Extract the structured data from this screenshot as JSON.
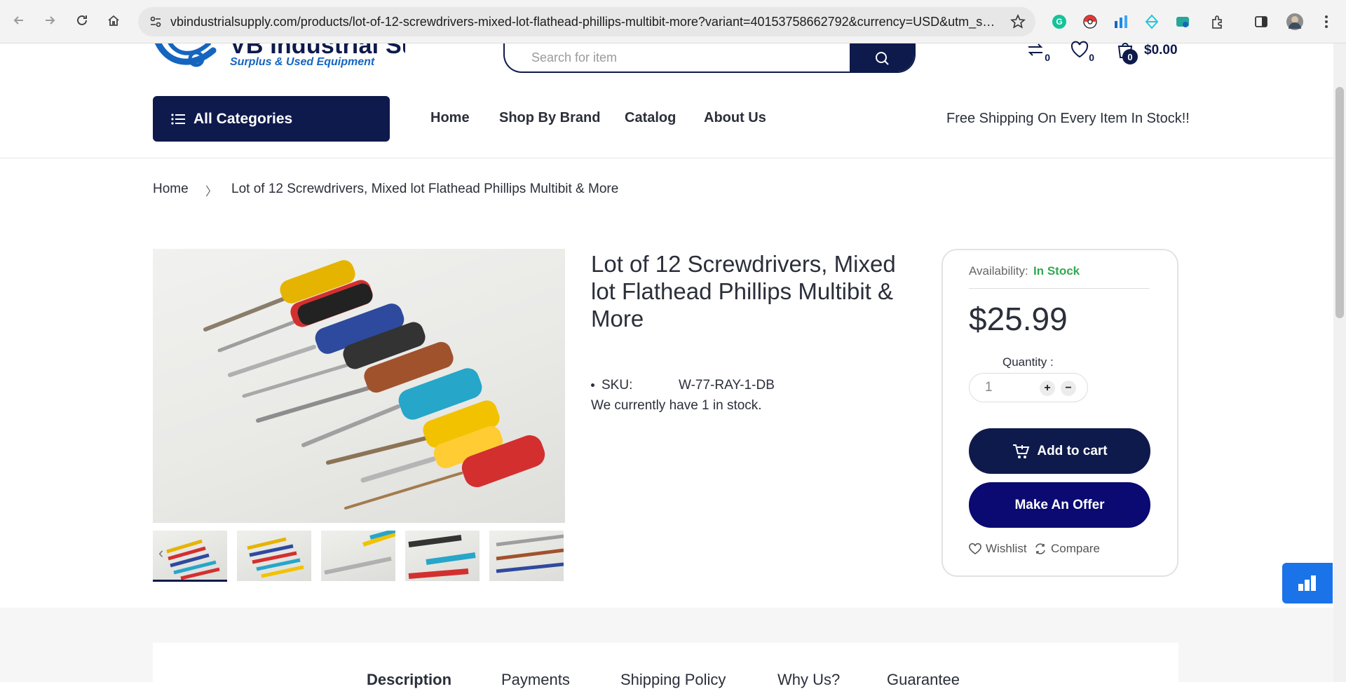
{
  "browser": {
    "url": "vbindustrialsupply.com/products/lot-of-12-screwdrivers-mixed-lot-flathead-phillips-multibit-more?variant=40153758662792&currency=USD&utm_sour..."
  },
  "header": {
    "logo_brand": "VB Industrial Supply",
    "logo_tagline": "Surplus & Used Equipment",
    "search_placeholder": "Search for item",
    "compare_count": "0",
    "wishlist_count": "0",
    "cart_count": "0",
    "cart_total": "$0.00",
    "all_categories": "All Categories",
    "menu": [
      "Home",
      "Shop By Brand",
      "Catalog",
      "About Us"
    ],
    "shipping_note": "Free Shipping On Every Item In Stock!!"
  },
  "breadcrumb": {
    "home": "Home",
    "separator": "〉",
    "current": "Lot of 12 Screwdrivers, Mixed lot Flathead Phillips Multibit & More"
  },
  "product": {
    "title": "Lot of 12 Screwdrivers, Mixed lot Flathead Phillips Multibit & More",
    "sku_label": "SKU:",
    "sku_value": "W-77-RAY-1-DB",
    "stock_note": "We currently have 1 in stock."
  },
  "buybox": {
    "availability_label": "Availability:",
    "availability_value": "In Stock",
    "price": "$25.99",
    "quantity_label": "Quantity :",
    "quantity_value": "1",
    "plus": "+",
    "minus": "−",
    "add_to_cart": "Add to cart",
    "make_offer": "Make An Offer",
    "wishlist": "Wishlist",
    "compare": "Compare"
  },
  "tabs": [
    "Description",
    "Payments",
    "Shipping Policy",
    "Why Us?",
    "Guarantee"
  ],
  "colors": {
    "navy": "#0e1a4b",
    "offer_blue": "#0a0a72",
    "in_stock_green": "#34a853",
    "widget_blue": "#1a73e8"
  }
}
